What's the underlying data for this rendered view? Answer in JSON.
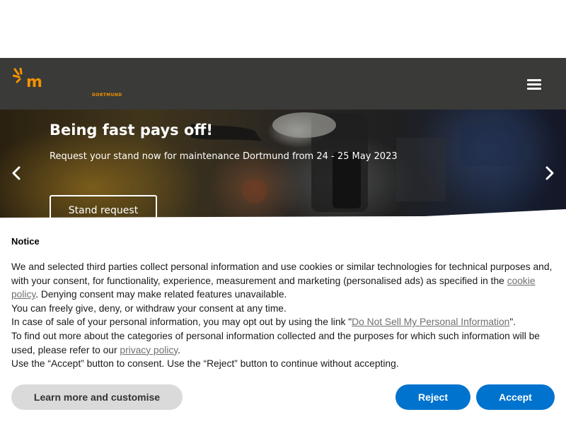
{
  "header": {
    "logo_letter": "m",
    "logo_city": "DORTMUND",
    "menu_icon": "hamburger-menu-icon",
    "accent_color": "#f39200",
    "background_color": "#3a3a38"
  },
  "hero": {
    "title": "Being fast pays off!",
    "subtitle": "Request your stand now for maintenance Dortmund from 24 - 25 May 2023",
    "cta_label": "Stand request",
    "prev_icon": "chevron-left-icon",
    "next_icon": "chevron-right-icon"
  },
  "notice": {
    "title": "Notice",
    "p1_before": "We and selected third parties collect personal information and use cookies or similar technologies for technical purposes and, with your consent, for functionality, experience, measurement and marketing (personalised ads) as specified in the ",
    "cookie_link": "cookie policy",
    "p1_after": ". Denying consent may make related features unavailable.",
    "p2": "You can freely give, deny, or withdraw your consent at any time.",
    "p3_before": "In case of sale of your personal information, you may opt out by using the link \"",
    "dns_link": "Do Not Sell My Personal Information",
    "p3_after": "\".",
    "p4_before": "To find out more about the categories of personal information collected and the purposes for which such information will be used, please refer to our ",
    "privacy_link": "privacy policy",
    "p4_after": ".",
    "p5": "Use the “Accept” button to consent. Use the “Reject” button to continue without accepting.",
    "learn_more_label": "Learn more and customise",
    "reject_label": "Reject",
    "accept_label": "Accept",
    "button_color": "#0073ce"
  }
}
